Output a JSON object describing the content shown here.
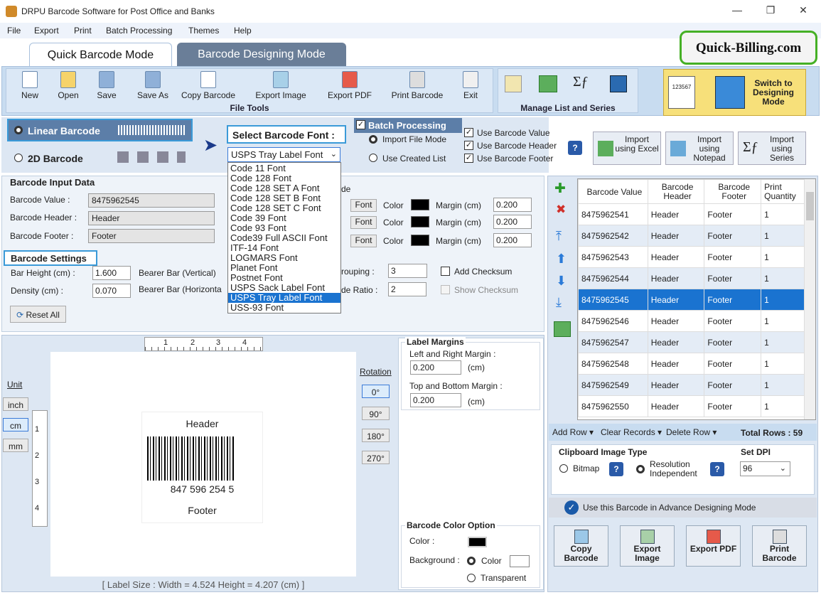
{
  "window": {
    "title": "DRPU Barcode Software for Post Office and Banks",
    "minimize": "—",
    "maximize": "❐",
    "close": "✕"
  },
  "menu": [
    "File",
    "Export",
    "Print",
    "Batch Processing",
    "Themes",
    "Help"
  ],
  "tabs": {
    "quick": "Quick Barcode Mode",
    "designing": "Barcode Designing Mode"
  },
  "brand": "Quick-Billing.com",
  "file_tools": {
    "label": "File Tools",
    "items": [
      "New",
      "Open",
      "Save",
      "Save As",
      "Copy Barcode",
      "Export Image",
      "Export PDF",
      "Print Barcode",
      "Exit"
    ]
  },
  "manage": {
    "label": "Manage List and Series"
  },
  "switch": {
    "label": "Switch to Designing Mode",
    "sample": "123567"
  },
  "barcode_type": {
    "linear": "Linear Barcode",
    "two_d": "2D Barcode"
  },
  "font_select": {
    "label": "Select Barcode Font :",
    "value": "USPS Tray Label Font",
    "options": [
      "Code 11 Font",
      "Code 128 Font",
      "Code 128 SET A Font",
      "Code 128 SET B Font",
      "Code 128 SET C Font",
      "Code 39 Font",
      "Code 93 Font",
      "Code39 Full ASCII Font",
      "ITF-14 Font",
      "LOGMARS Font",
      "Planet Font",
      "Postnet Font",
      "USPS Sack Label Font",
      "USPS Tray Label Font",
      "USS-93 Font"
    ],
    "selected_index": 13
  },
  "batch": {
    "title": "Batch Processing",
    "import_file": "Import File Mode",
    "use_created": "Use Created List",
    "use_value": "Use Barcode Value",
    "use_header": "Use Barcode Header",
    "use_footer": "Use Barcode Footer",
    "help": "?"
  },
  "imports": [
    {
      "label": "Import using Excel"
    },
    {
      "label": "Import using Notepad"
    },
    {
      "label": "Import using Series"
    }
  ],
  "input_data": {
    "title": "Barcode Input Data",
    "value_label": "Barcode Value :",
    "value": "8475962545",
    "header_label": "Barcode Header :",
    "header": "Header",
    "footer_label": "Barcode Footer :",
    "footer": "Footer",
    "mode_frag": "de"
  },
  "font_rows": [
    {
      "font": "Font",
      "color": "Color",
      "margin_label": "Margin (cm)",
      "margin": "0.200"
    },
    {
      "font": "Font",
      "color": "Color",
      "margin_label": "Margin (cm)",
      "margin": "0.200"
    },
    {
      "font": "Font",
      "color": "Color",
      "margin_label": "Margin (cm)",
      "margin": "0.200"
    }
  ],
  "settings": {
    "title": "Barcode Settings",
    "bar_height_label": "Bar Height (cm) :",
    "bar_height": "1.600",
    "density_label": "Density (cm) :",
    "density": "0.070",
    "bearer_v": "Bearer Bar (Vertical)",
    "bearer_h": "Bearer Bar (Horizonta",
    "grouping_label": "rouping :",
    "grouping": "3",
    "ratio_label": "de Ratio :",
    "ratio": "2",
    "add_checksum": "Add Checksum",
    "show_checksum": "Show Checksum",
    "reset": "Reset All"
  },
  "preview": {
    "unit_label": "Unit",
    "units": [
      "inch",
      "cm",
      "mm"
    ],
    "ruler_top": [
      "1",
      "2",
      "3",
      "4"
    ],
    "ruler_left": [
      "1",
      "2",
      "3",
      "4"
    ],
    "header": "Header",
    "digits": "847 596 254 5",
    "footer": "Footer",
    "label_size": "[ Label Size : Width = 4.524  Height = 4.207 (cm) ]"
  },
  "rotation": {
    "label": "Rotation",
    "options": [
      "0°",
      "90°",
      "180°",
      "270°"
    ]
  },
  "label_margins": {
    "title": "Label Margins",
    "lr_label": "Left and Right Margin :",
    "lr": "0.200",
    "tb_label": "Top and Bottom Margin :",
    "tb": "0.200",
    "unit": "(cm)"
  },
  "color_option": {
    "title": "Barcode Color Option",
    "color_label": "Color :",
    "bg_label": "Background :",
    "color_radio": "Color",
    "transparent": "Transparent"
  },
  "table": {
    "headers": [
      "Barcode Value",
      "Barcode Header",
      "Barcode Footer",
      "Print Quantity"
    ],
    "rows": [
      [
        "8475962541",
        "Header",
        "Footer",
        "1"
      ],
      [
        "8475962542",
        "Header",
        "Footer",
        "1"
      ],
      [
        "8475962543",
        "Header",
        "Footer",
        "1"
      ],
      [
        "8475962544",
        "Header",
        "Footer",
        "1"
      ],
      [
        "8475962545",
        "Header",
        "Footer",
        "1"
      ],
      [
        "8475962546",
        "Header",
        "Footer",
        "1"
      ],
      [
        "8475962547",
        "Header",
        "Footer",
        "1"
      ],
      [
        "8475962548",
        "Header",
        "Footer",
        "1"
      ],
      [
        "8475962549",
        "Header",
        "Footer",
        "1"
      ],
      [
        "8475962550",
        "Header",
        "Footer",
        "1"
      ]
    ],
    "selected_row": 4
  },
  "table_bar": {
    "add_row": "Add Row",
    "clear": "Clear Records",
    "delete_row": "Delete Row",
    "total": "Total Rows : 59"
  },
  "clipboard": {
    "title": "Clipboard Image Type",
    "bitmap": "Bitmap",
    "resolution": "Resolution Independent",
    "dpi_title": "Set DPI",
    "dpi": "96"
  },
  "advance": "Use this Barcode in Advance Designing Mode",
  "actions": [
    "Copy Barcode",
    "Export Image",
    "Export PDF",
    "Print Barcode"
  ]
}
